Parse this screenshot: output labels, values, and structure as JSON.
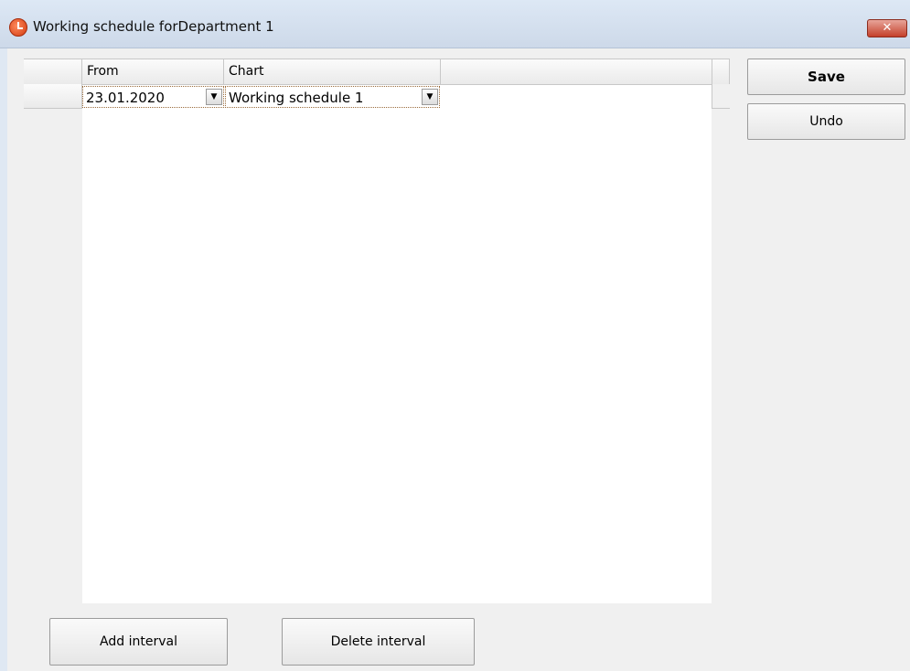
{
  "window": {
    "title": "Working schedule forDepartment 1",
    "close_label": "✕"
  },
  "grid": {
    "columns": [
      "From",
      "Chart"
    ],
    "rows": [
      {
        "from": "23.01.2020",
        "chart": "Working schedule 1"
      }
    ]
  },
  "actions": {
    "save_label": "Save",
    "undo_label": "Undo",
    "add_interval_label": "Add interval",
    "delete_interval_label": "Delete interval"
  },
  "icons": {
    "app": "clock-icon",
    "dropdown": "chevron-down-icon",
    "close": "close-icon"
  },
  "colors": {
    "titlebar": "#d6e2f0",
    "close_button": "#c4402a",
    "grid_background": "#ffffff",
    "window_background": "#f0f0f0"
  }
}
